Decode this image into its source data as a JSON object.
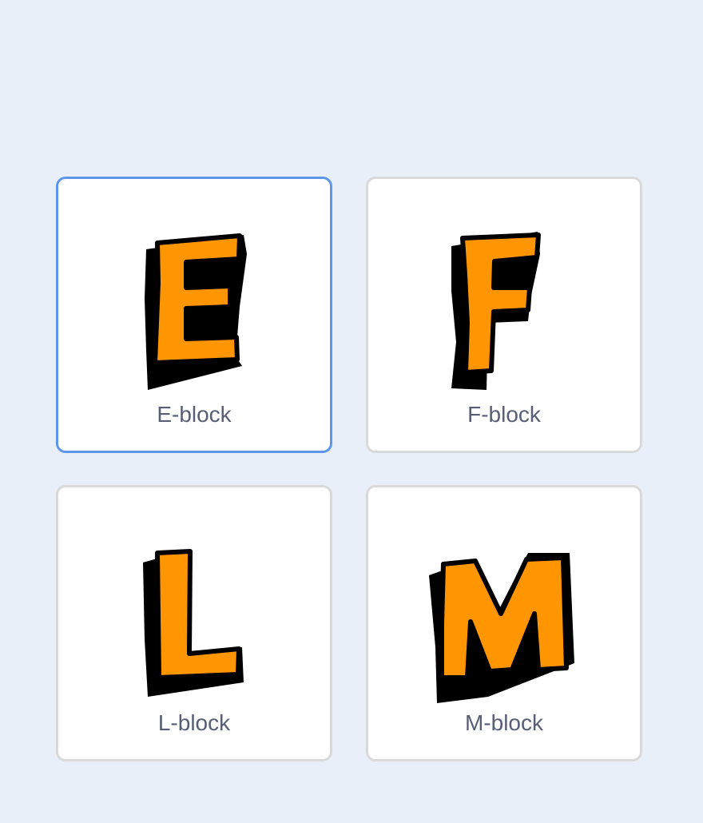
{
  "sprites": [
    {
      "label": "E-block",
      "letter": "E",
      "icon": "letter-e-block-icon",
      "selected": true
    },
    {
      "label": "F-block",
      "letter": "F",
      "icon": "letter-f-block-icon",
      "selected": false
    },
    {
      "label": "L-block",
      "letter": "L",
      "icon": "letter-l-block-icon",
      "selected": false
    },
    {
      "label": "M-block",
      "letter": "M",
      "icon": "letter-m-block-icon",
      "selected": false
    }
  ],
  "colors": {
    "page_background": "#e8eff9",
    "card_background": "#ffffff",
    "card_border": "#d9d9d9",
    "selected_border": "#5e97ea",
    "letter_fill": "#ff9500",
    "letter_outline": "#000000",
    "label_text": "#575e75"
  }
}
